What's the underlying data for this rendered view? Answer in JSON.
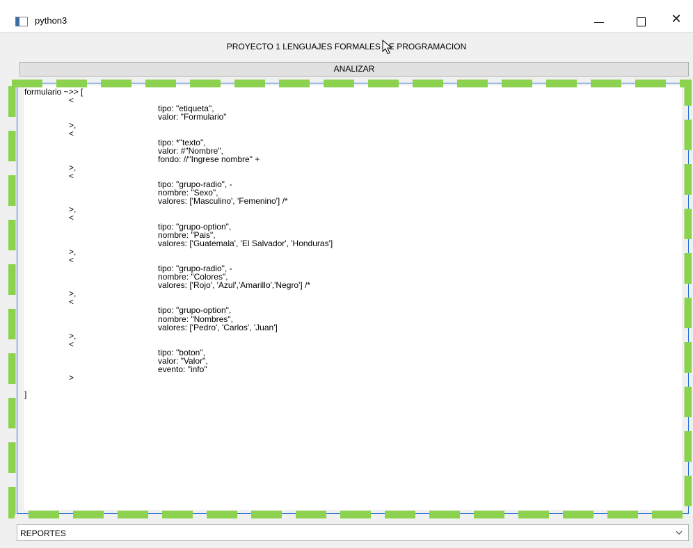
{
  "window": {
    "title": "python3",
    "icon": "app-window-icon",
    "controls": [
      "minimize-icon",
      "maximize-icon",
      "close-icon"
    ],
    "close_glyph": "✕"
  },
  "header": {
    "label": "PROYECTO 1 LENGUAJES FORMALES DE PROGRAMACION"
  },
  "toolbar": {
    "analyze_label": "ANALIZAR"
  },
  "editor": {
    "focus_border_color": "#8cd24e",
    "lines": [
      "formulario ~>> [",
      "\t\t<",
      "\t\t\t\t\t\ttipo: \"etiqueta\",",
      "\t\t\t\t\t\tvalor: \"Formulario\"",
      "\t\t>,",
      "\t\t<",
      "\t\t\t\t\t\ttipo: *\"texto\",",
      "\t\t\t\t\t\tvalor: #\"Nombre\",",
      "\t\t\t\t\t\tfondo: //\"Ingrese nombre\" +",
      "\t\t>,",
      "\t\t<",
      "\t\t\t\t\t\ttipo: \"grupo-radio\", -",
      "\t\t\t\t\t\tnombre: \"Sexo\",",
      "\t\t\t\t\t\tvalores: ['Masculino', 'Femenino'] /*",
      "\t\t>,",
      "\t\t<",
      "\t\t\t\t\t\ttipo: \"grupo-option\",",
      "\t\t\t\t\t\tnombre: \"Pais\",",
      "\t\t\t\t\t\tvalores: ['Guatemala', 'El Salvador', 'Honduras']",
      "\t\t>,",
      "\t\t<",
      "\t\t\t\t\t\ttipo: \"grupo-radio\", -",
      "\t\t\t\t\t\tnombre: \"Colores\",",
      "\t\t\t\t\t\tvalores: ['Rojo', 'Azul','Amarillo','Negro'] /*",
      "\t\t>,",
      "\t\t<",
      "\t\t\t\t\t\ttipo: \"grupo-option\",",
      "\t\t\t\t\t\tnombre: \"Nombres\",",
      "\t\t\t\t\t\tvalores: ['Pedro', 'Carlos', 'Juan']",
      "\t\t>,",
      "\t\t<",
      "\t\t\t\t\t\ttipo: \"boton\",",
      "\t\t\t\t\t\tvalor: \"Valor\",",
      "\t\t\t\t\t\tevento: \"info\"",
      "\t\t>",
      "",
      "]"
    ]
  },
  "reports": {
    "selected": "REPORTES",
    "icon": "chevron-down-icon"
  }
}
